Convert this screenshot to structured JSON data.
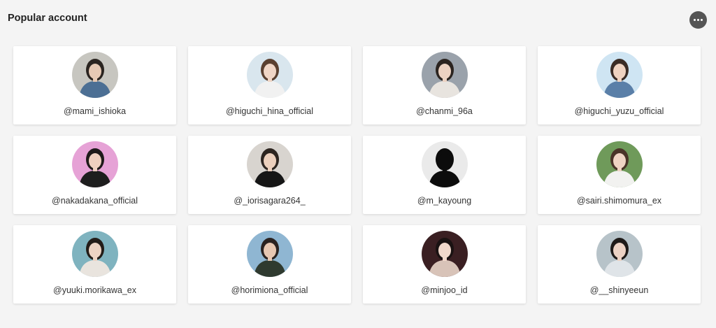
{
  "header": {
    "title": "Popular account",
    "more_icon": "more-horizontal-icon"
  },
  "accounts": [
    {
      "handle": "@mami_ishioka",
      "bg": "#c7c6c0",
      "hair": "#2a2420",
      "clothes": "#4c6f94",
      "skin": "#e6c9b4"
    },
    {
      "handle": "@higuchi_hina_official",
      "bg": "#d9e6ee",
      "hair": "#5a4030",
      "clothes": "#f1f1f1",
      "skin": "#f0d6c6"
    },
    {
      "handle": "@chanmi_96a",
      "bg": "#9aa2ab",
      "hair": "#2b2420",
      "clothes": "#e8e4df",
      "skin": "#ecd2c2"
    },
    {
      "handle": "@higuchi_yuzu_official",
      "bg": "#cfe5f3",
      "hair": "#3a2c25",
      "clothes": "#5a7fa8",
      "skin": "#efd3c1"
    },
    {
      "handle": "@nakadakana_official",
      "bg": "#e6a2d6",
      "hair": "#1e1a1a",
      "clothes": "#1e1e1e",
      "skin": "#efd0c0"
    },
    {
      "handle": "@_iorisagara264_",
      "bg": "#d8d4cf",
      "hair": "#2d2520",
      "clothes": "#161616",
      "skin": "#ecd0bd"
    },
    {
      "handle": "@m_kayoung",
      "bg": "#eaeaea",
      "hair": "#0c0c0c",
      "clothes": "#0c0c0c",
      "skin": "#0c0c0c"
    },
    {
      "handle": "@sairi.shimomura_ex",
      "bg": "#6f9a5a",
      "hair": "#4a3428",
      "clothes": "#f2f2f0",
      "skin": "#efd4c3"
    },
    {
      "handle": "@yuuki.morikawa_ex",
      "bg": "#7fb3bf",
      "hair": "#231c18",
      "clothes": "#e9e4de",
      "skin": "#edd3c3"
    },
    {
      "handle": "@horimiona_official",
      "bg": "#8fb6d2",
      "hair": "#2a2220",
      "clothes": "#2f3a2f",
      "skin": "#e7c7b2"
    },
    {
      "handle": "@minjoo_id",
      "bg": "#3a1f22",
      "hair": "#1a1212",
      "clothes": "#d8c3b8",
      "skin": "#f1d8cb"
    },
    {
      "handle": "@__shinyeeun",
      "bg": "#b7c3c9",
      "hair": "#1e1a18",
      "clothes": "#dfe4e8",
      "skin": "#ecd2c4"
    }
  ]
}
